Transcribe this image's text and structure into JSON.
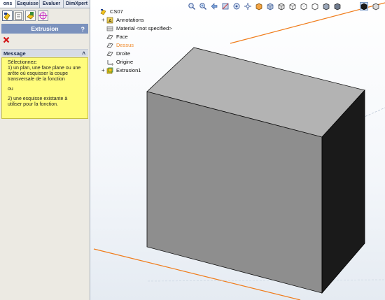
{
  "tabs": [
    "ons",
    "Esquisse",
    "Evaluer",
    "DimXpert"
  ],
  "property_manager": {
    "title": "Extrusion",
    "help_label": "?",
    "message_header": "Message",
    "message_lines": [
      "Sélectionnez:",
      "1) un plan, une face plane ou une",
      "arête où esquisser la coupe",
      "transversale de la fonction"
    ],
    "message_or": "ou",
    "message_lines2": [
      "2) une esquisse existante à",
      "utiliser pour la fonction."
    ]
  },
  "tree": {
    "root": "CS07",
    "items": [
      "Annotations",
      "Material <not specified>",
      "Face",
      "Dessus",
      "Droite",
      "Origine",
      "Extrusion1"
    ]
  },
  "colors": {
    "title_bar": "#7b92bd",
    "message_bg": "#fffc7c",
    "selected_tree_item": "#f08a2c",
    "orange_edge": "#f07c1a",
    "box_front": "#8e8e8e",
    "box_top": "#b3b3b3",
    "box_side": "#1a1a1a"
  },
  "toolbar_icons": [
    "zoom-to-fit-icon",
    "zoom-area-icon",
    "previous-view-icon",
    "section-view-icon",
    "dynamic-annotation-icon",
    "view-orientation-icon",
    "display-style-icon",
    "hide-show-icon",
    "edit-appearance-icon",
    "apply-scene-icon",
    "view-settings-icon",
    "shaded-edges-icon",
    "shaded-icon",
    "active-view-icon",
    "extra-icon"
  ]
}
